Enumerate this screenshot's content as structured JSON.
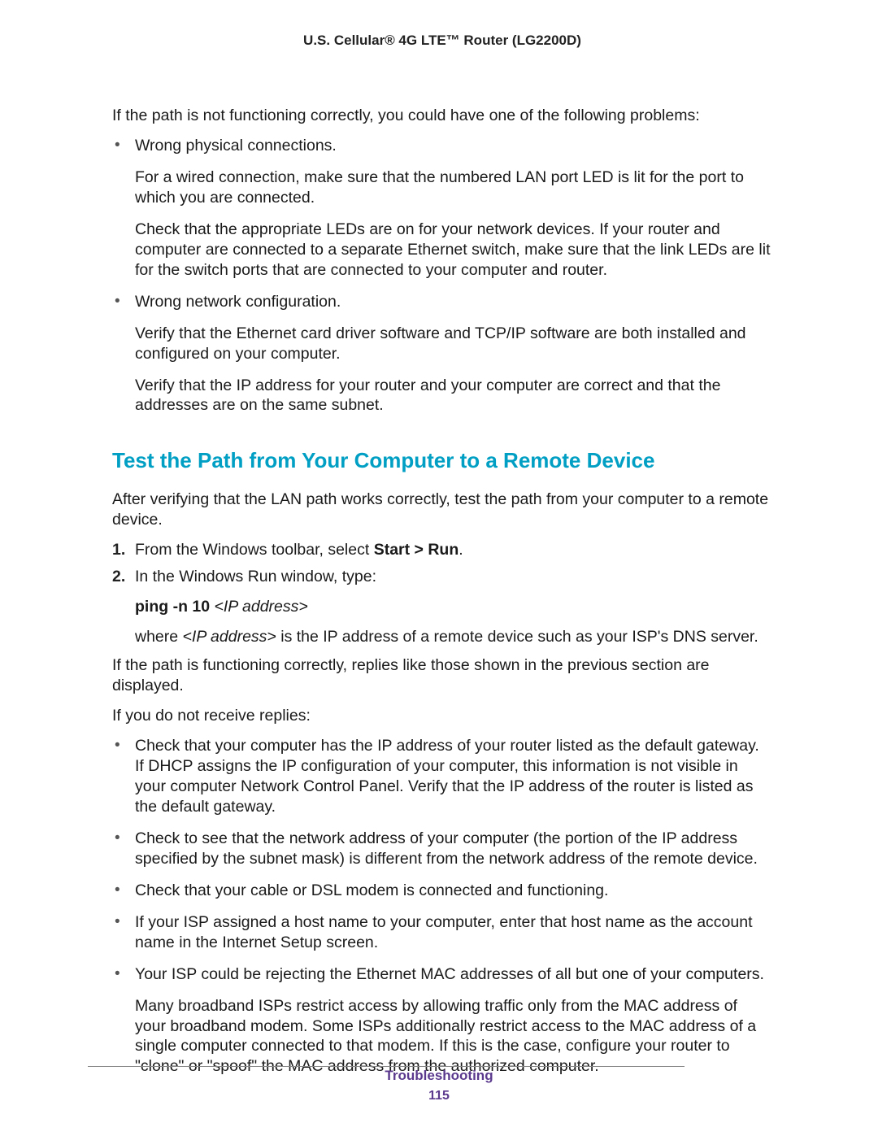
{
  "header": {
    "title": "U.S. Cellular® 4G LTE™ Router (LG2200D)"
  },
  "intro": "If the path is not functioning correctly, you could have one of the following problems:",
  "problems": [
    {
      "title": "Wrong physical connections.",
      "paras": [
        "For a wired connection, make sure that the numbered LAN port LED is lit for the port to which you are connected.",
        "Check that the appropriate LEDs are on for your network devices. If your router and computer are connected to a separate Ethernet switch, make sure that the link LEDs are lit for the switch ports that are connected to your computer and router."
      ]
    },
    {
      "title": "Wrong network configuration.",
      "paras": [
        "Verify that the Ethernet card driver software and TCP/IP software are both installed and configured on your computer.",
        "Verify that the IP address for your router and your computer are correct and that the addresses are on the same subnet."
      ]
    }
  ],
  "section_heading": "Test the Path from Your Computer to a Remote Device",
  "section_intro": "After verifying that the LAN path works correctly, test the path from your computer to a remote device.",
  "steps": {
    "step1_prefix": "From the Windows toolbar, select ",
    "step1_bold": "Start > Run",
    "step1_suffix": ".",
    "step2_text": "In the Windows Run window, type:",
    "ping_bold": "ping -n 10 ",
    "ping_italic": "<IP address>",
    "where_prefix": "where ",
    "where_italic": "<IP address>",
    "where_suffix": " is the IP address of a remote device such as your ISP's DNS server."
  },
  "after_steps": [
    "If the path is functioning correctly, replies like those shown in the previous section are displayed.",
    "If you do not receive replies:"
  ],
  "checks": [
    "Check that your computer has the IP address of your router listed as the default gateway. If DHCP assigns the IP configuration of your computer, this information is not visible in your computer Network Control Panel. Verify that the IP address of the router is listed as the default gateway.",
    "Check to see that the network address of your computer (the portion of the IP address specified by the subnet mask) is different from the network address of the remote device.",
    "Check that your cable or DSL modem is connected and functioning.",
    "If your ISP assigned a host name to your computer, enter that host name as the account name in the Internet Setup screen."
  ],
  "last_check_title": "Your ISP could be rejecting the Ethernet MAC addresses of all but one of your computers.",
  "last_check_para": "Many broadband ISPs restrict access by allowing traffic only from the MAC address of your broadband modem. Some ISPs additionally restrict access to the MAC address of a single computer connected to that modem. If this is the case, configure your router to \"clone\" or \"spoof\" the MAC address from the authorized computer.",
  "footer": {
    "section": "Troubleshooting",
    "page": "115"
  }
}
